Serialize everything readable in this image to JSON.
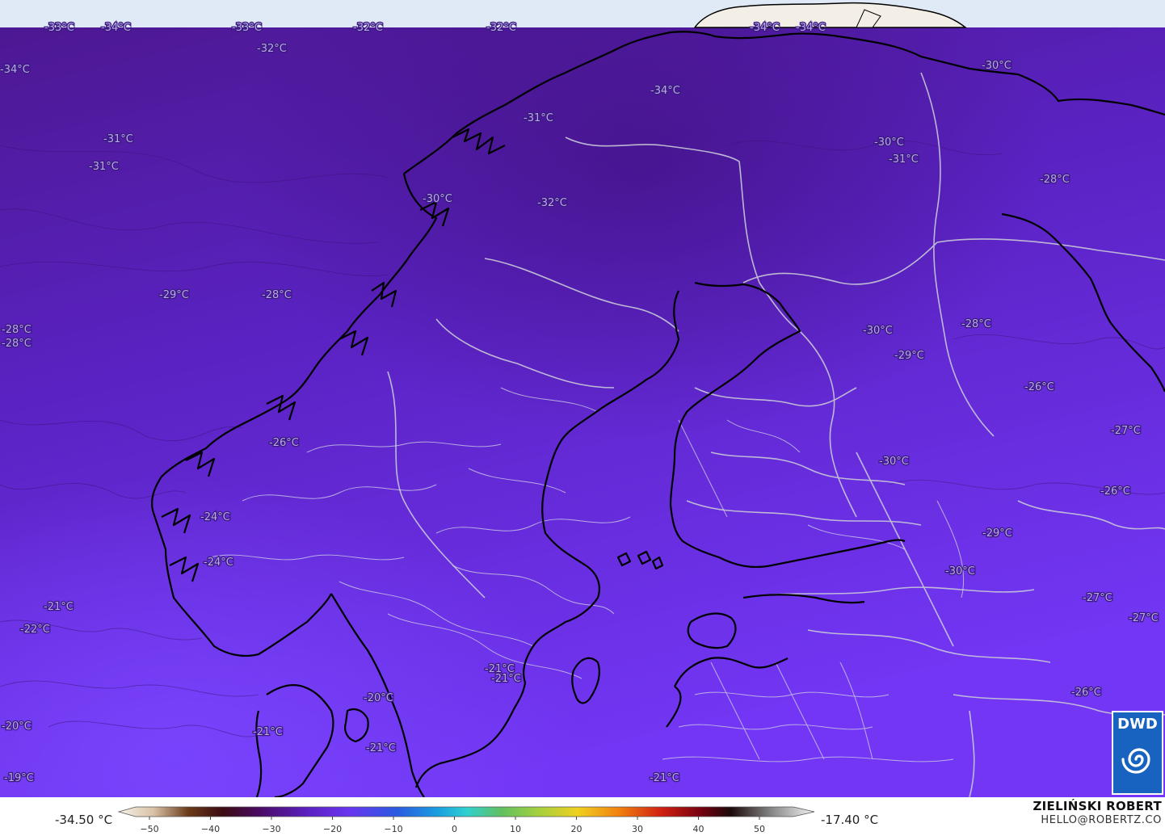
{
  "labels": [
    {
      "text": "-33°C"
    },
    {
      "text": "-34°C"
    },
    {
      "text": "-33°C"
    },
    {
      "text": "-32°C"
    },
    {
      "text": "-32°C"
    },
    {
      "text": "-32°C"
    },
    {
      "text": "-34°C"
    },
    {
      "text": "-34°C"
    },
    {
      "text": "-34°C"
    },
    {
      "text": "-30°C"
    },
    {
      "text": "-34°C"
    },
    {
      "text": "-31°C"
    },
    {
      "text": "-31°C"
    },
    {
      "text": "-31°C"
    },
    {
      "text": "-30°C"
    },
    {
      "text": "-31°C"
    },
    {
      "text": "-28°C"
    },
    {
      "text": "-30°C"
    },
    {
      "text": "-32°C"
    },
    {
      "text": "-29°C"
    },
    {
      "text": "-28°C"
    },
    {
      "text": "-28°C"
    },
    {
      "text": "-28°C"
    },
    {
      "text": "-28°C"
    },
    {
      "text": "-30°C"
    },
    {
      "text": "-29°C"
    },
    {
      "text": "-26°C"
    },
    {
      "text": "-27°C"
    },
    {
      "text": "-26°C"
    },
    {
      "text": "-30°C"
    },
    {
      "text": "-26°C"
    },
    {
      "text": "-24°C"
    },
    {
      "text": "-24°C"
    },
    {
      "text": "-29°C"
    },
    {
      "text": "-30°C"
    },
    {
      "text": "-27°C"
    },
    {
      "text": "-21°C"
    },
    {
      "text": "-22°C"
    },
    {
      "text": "-27°C"
    },
    {
      "text": "-21°C"
    },
    {
      "text": "-21°C"
    },
    {
      "text": "-20°C"
    },
    {
      "text": "-26°C"
    },
    {
      "text": "-20°C"
    },
    {
      "text": "-21°C"
    },
    {
      "text": "-21°C"
    },
    {
      "text": "-19°C"
    },
    {
      "text": "-21°C"
    }
  ],
  "colorbar": {
    "min_label": "-34.50 °C",
    "max_label": "-17.40 °C",
    "ticks": [
      "−50",
      "−40",
      "−30",
      "−20",
      "−10",
      "0",
      "10",
      "20",
      "30",
      "40",
      "50"
    ]
  },
  "author": {
    "name": "ZIELIŃSKI ROBERT",
    "email": "HELLO@ROBERTZ.CO"
  },
  "logo": {
    "text": "DWD"
  },
  "colors": {
    "sea_ice": "#dfeaf6",
    "cold": "#4a1590",
    "mid": "#6a2ce0",
    "warm": "#7a3cff",
    "border": "#c8c8d8",
    "coast": "#000000"
  }
}
